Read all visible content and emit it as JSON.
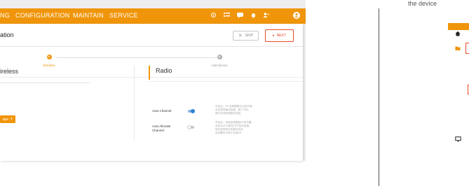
{
  "nav": {
    "items": [
      "NG",
      "CONFIGURATION",
      "MAINTAIN",
      "SERVICE"
    ]
  },
  "page": {
    "title": "ation",
    "skip_label": "SKIP",
    "next_label": "NEXT"
  },
  "steps": [
    "Wireless",
    "Add Device"
  ],
  "wireless": {
    "title": "ireless",
    "add_label": "ape"
  },
  "radio": {
    "title": "Radio",
    "auto_channel_label": "Auto Channel:",
    "auto_allocate_label_1": "Auto Allocate",
    "auto_allocate_label_2": "Channel:",
    "auto_channel_on": true,
    "auto_allocate_on": false,
    "note1": [
      "开启后，AP 会根据周边无线环境，",
      "自动选择最优信道，减少干扰，",
      "提升无线网络整体性能。"
    ],
    "note2": [
      "开启后，系统会根据各AP的位置，",
      "自动为AP分配互不干扰的信道，",
      "使无线网络达到最佳状态，",
      "此设置仅作用于全部AP。"
    ]
  },
  "right": {
    "top_text": "the device"
  },
  "colors": {
    "accent": "#f0950a",
    "toggle_on": "#2e82d2",
    "red": "#e8492a"
  }
}
